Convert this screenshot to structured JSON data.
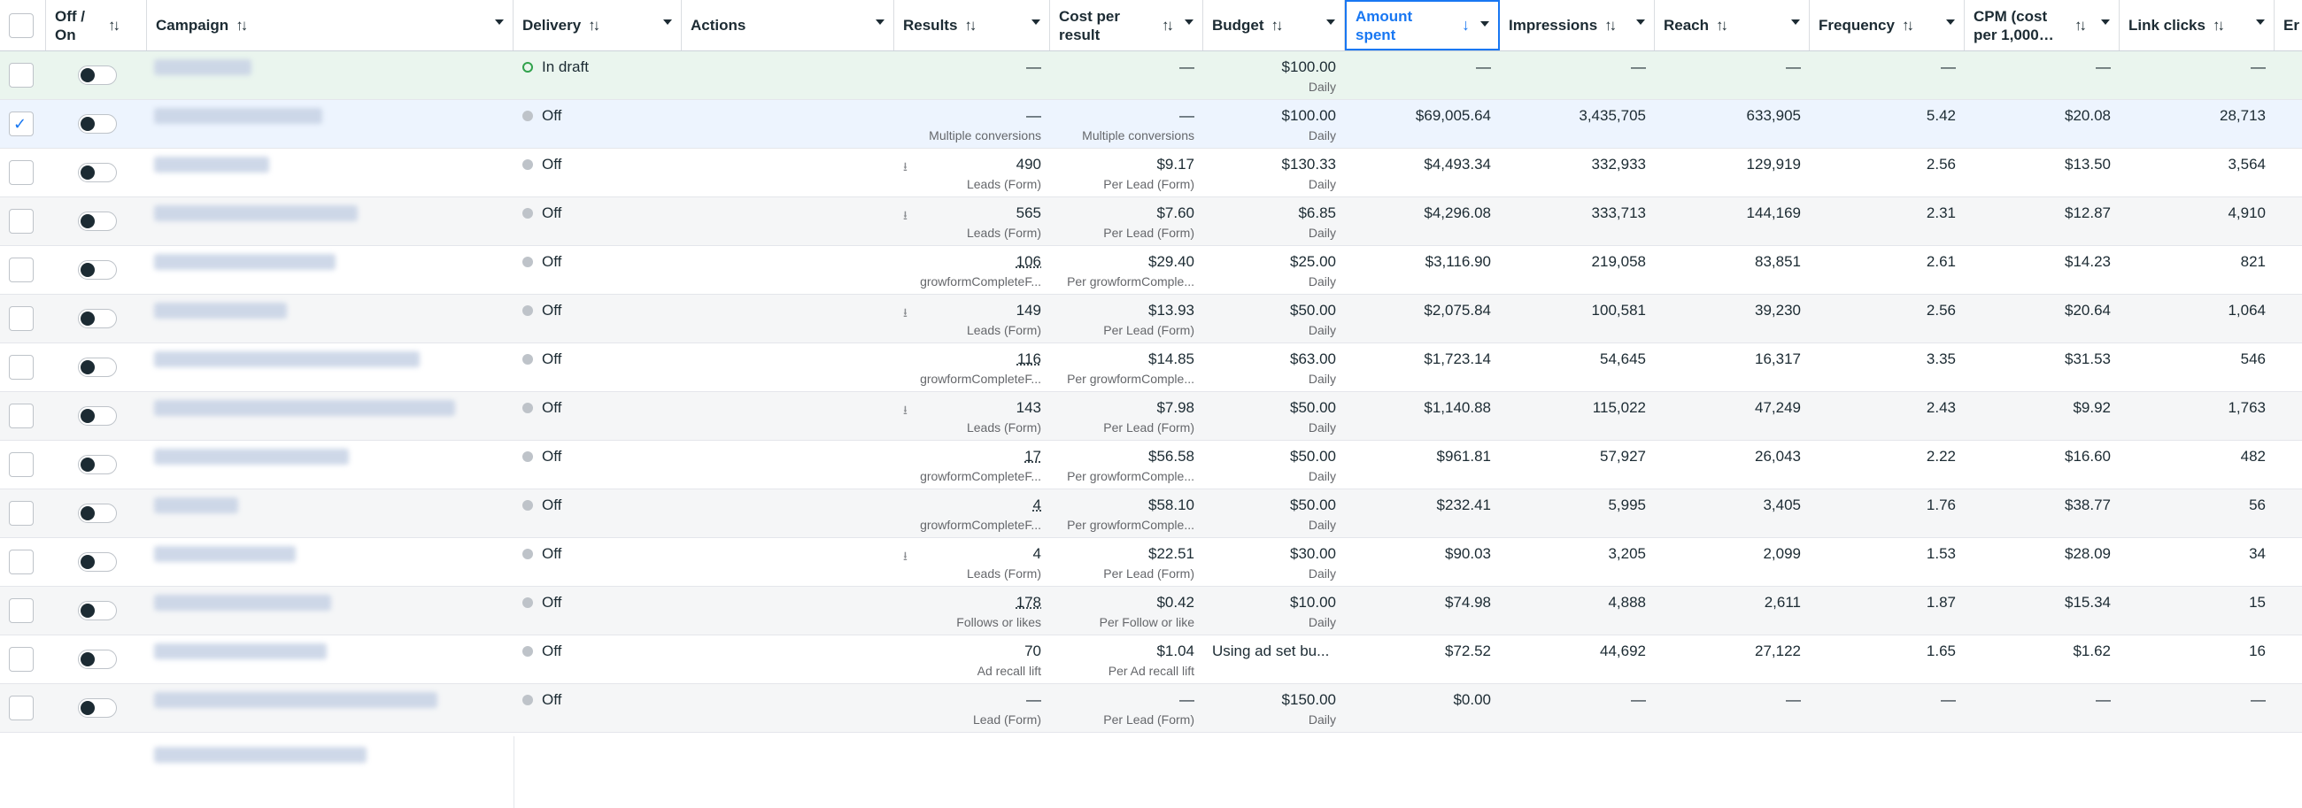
{
  "header": {
    "toggle": "Off / On",
    "campaign": "Campaign",
    "delivery": "Delivery",
    "actions": "Actions",
    "results": "Results",
    "cost_per_result": "Cost per result",
    "budget": "Budget",
    "amount_spent": "Amount spent",
    "impressions": "Impressions",
    "reach": "Reach",
    "frequency": "Frequency",
    "cpm": "CPM (cost per 1,000…",
    "link_clicks": "Link clicks",
    "extra": "Er"
  },
  "rows": [
    {
      "delivery": "In draft",
      "results": "—",
      "results_sub": "",
      "cpr": "—",
      "cpr_sub": "",
      "budget": "$100.00",
      "budget_sub": "Daily",
      "spent": "—",
      "impressions": "—",
      "reach": "—",
      "frequency": "—",
      "cpm": "—",
      "clicks": "—"
    },
    {
      "delivery": "Off",
      "results": "—",
      "results_sub": "Multiple conversions",
      "cpr": "—",
      "cpr_sub": "Multiple conversions",
      "budget": "$100.00",
      "budget_sub": "Daily",
      "spent": "$69,005.64",
      "impressions": "3,435,705",
      "reach": "633,905",
      "frequency": "5.42",
      "cpm": "$20.08",
      "clicks": "28,713"
    },
    {
      "delivery": "Off",
      "results": "490",
      "results_sub": "Leads (Form)",
      "cpr": "$9.17",
      "cpr_sub": "Per Lead (Form)",
      "budget": "$130.33",
      "budget_sub": "Daily",
      "spent": "$4,493.34",
      "impressions": "332,933",
      "reach": "129,919",
      "frequency": "2.56",
      "cpm": "$13.50",
      "clicks": "3,564"
    },
    {
      "delivery": "Off",
      "results": "565",
      "results_sub": "Leads (Form)",
      "cpr": "$7.60",
      "cpr_sub": "Per Lead (Form)",
      "budget": "$6.85",
      "budget_sub": "Daily",
      "spent": "$4,296.08",
      "impressions": "333,713",
      "reach": "144,169",
      "frequency": "2.31",
      "cpm": "$12.87",
      "clicks": "4,910"
    },
    {
      "delivery": "Off",
      "results": "106",
      "results_sub": "growformCompleteF...",
      "cpr": "$29.40",
      "cpr_sub": "Per growformComple...",
      "budget": "$25.00",
      "budget_sub": "Daily",
      "spent": "$3,116.90",
      "impressions": "219,058",
      "reach": "83,851",
      "frequency": "2.61",
      "cpm": "$14.23",
      "clicks": "821"
    },
    {
      "delivery": "Off",
      "results": "149",
      "results_sub": "Leads (Form)",
      "cpr": "$13.93",
      "cpr_sub": "Per Lead (Form)",
      "budget": "$50.00",
      "budget_sub": "Daily",
      "spent": "$2,075.84",
      "impressions": "100,581",
      "reach": "39,230",
      "frequency": "2.56",
      "cpm": "$20.64",
      "clicks": "1,064"
    },
    {
      "delivery": "Off",
      "results": "116",
      "results_sub": "growformCompleteF...",
      "cpr": "$14.85",
      "cpr_sub": "Per growformComple...",
      "budget": "$63.00",
      "budget_sub": "Daily",
      "spent": "$1,723.14",
      "impressions": "54,645",
      "reach": "16,317",
      "frequency": "3.35",
      "cpm": "$31.53",
      "clicks": "546"
    },
    {
      "delivery": "Off",
      "results": "143",
      "results_sub": "Leads (Form)",
      "cpr": "$7.98",
      "cpr_sub": "Per Lead (Form)",
      "budget": "$50.00",
      "budget_sub": "Daily",
      "spent": "$1,140.88",
      "impressions": "115,022",
      "reach": "47,249",
      "frequency": "2.43",
      "cpm": "$9.92",
      "clicks": "1,763"
    },
    {
      "delivery": "Off",
      "results": "17",
      "results_sub": "growformCompleteF...",
      "cpr": "$56.58",
      "cpr_sub": "Per growformComple...",
      "budget": "$50.00",
      "budget_sub": "Daily",
      "spent": "$961.81",
      "impressions": "57,927",
      "reach": "26,043",
      "frequency": "2.22",
      "cpm": "$16.60",
      "clicks": "482"
    },
    {
      "delivery": "Off",
      "results": "4",
      "results_sub": "growformCompleteF...",
      "cpr": "$58.10",
      "cpr_sub": "Per growformComple...",
      "budget": "$50.00",
      "budget_sub": "Daily",
      "spent": "$232.41",
      "impressions": "5,995",
      "reach": "3,405",
      "frequency": "1.76",
      "cpm": "$38.77",
      "clicks": "56"
    },
    {
      "delivery": "Off",
      "results": "4",
      "results_sub": "Leads (Form)",
      "cpr": "$22.51",
      "cpr_sub": "Per Lead (Form)",
      "budget": "$30.00",
      "budget_sub": "Daily",
      "spent": "$90.03",
      "impressions": "3,205",
      "reach": "2,099",
      "frequency": "1.53",
      "cpm": "$28.09",
      "clicks": "34"
    },
    {
      "delivery": "Off",
      "results": "178",
      "results_sub": "Follows or likes",
      "cpr": "$0.42",
      "cpr_sub": "Per Follow or like",
      "budget": "$10.00",
      "budget_sub": "Daily",
      "spent": "$74.98",
      "impressions": "4,888",
      "reach": "2,611",
      "frequency": "1.87",
      "cpm": "$15.34",
      "clicks": "15"
    },
    {
      "delivery": "Off",
      "results": "70",
      "results_sub": "Ad recall lift",
      "cpr": "$1.04",
      "cpr_sub": "Per Ad recall lift",
      "budget": "Using ad set bu...",
      "budget_sub": "",
      "spent": "$72.52",
      "impressions": "44,692",
      "reach": "27,122",
      "frequency": "1.65",
      "cpm": "$1.62",
      "clicks": "16"
    },
    {
      "delivery": "Off",
      "results": "—",
      "results_sub": "Lead (Form)",
      "cpr": "—",
      "cpr_sub": "Per Lead (Form)",
      "budget": "$150.00",
      "budget_sub": "Daily",
      "spent": "$0.00",
      "impressions": "—",
      "reach": "—",
      "frequency": "—",
      "cpm": "—",
      "clicks": "—"
    }
  ],
  "colors": {
    "accent": "#1877f2",
    "draft_row": "#eaf5ee",
    "selected_row": "#edf4fe",
    "draft_dot": "#31a24c"
  }
}
